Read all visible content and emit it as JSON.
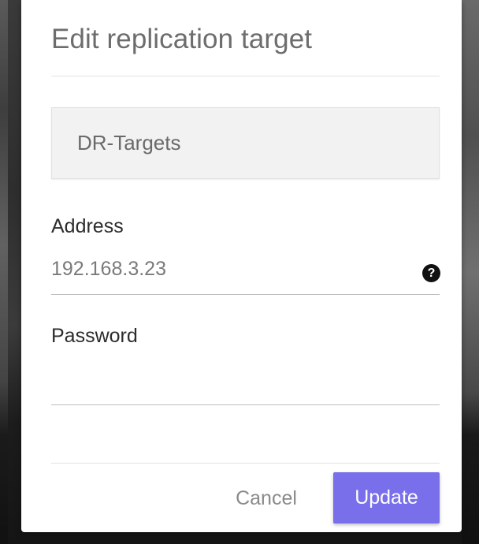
{
  "dialog": {
    "title": "Edit replication target",
    "target_group": "DR-Targets",
    "fields": {
      "address": {
        "label": "Address",
        "value": "192.168.3.23",
        "help_icon": "question-circle-icon"
      },
      "password": {
        "label": "Password",
        "value": ""
      }
    },
    "actions": {
      "cancel_label": "Cancel",
      "update_label": "Update"
    }
  },
  "colors": {
    "accent": "#7a6fea",
    "title_text": "#6d6d6d",
    "backdrop": "#2e2e2e"
  }
}
